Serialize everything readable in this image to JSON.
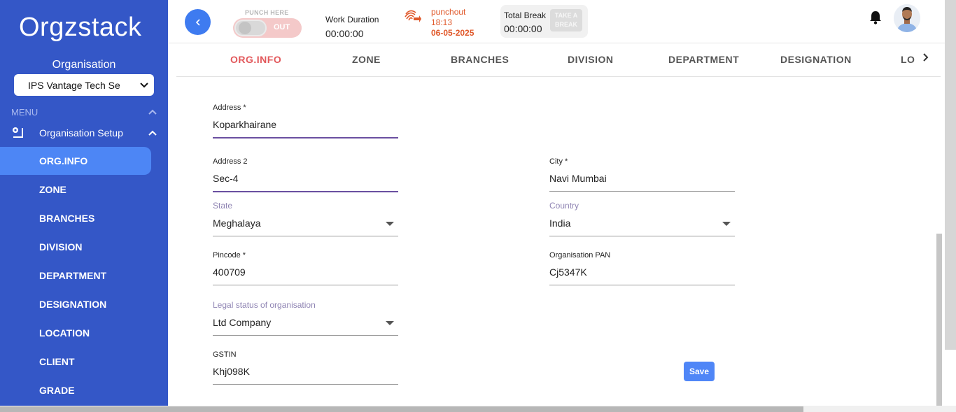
{
  "sidebar": {
    "logo": "Orgzstack",
    "org_label": "Organisation",
    "org_select_value": "IPS Vantage Tech Se",
    "menu_heading": "MENU",
    "setup_label": "Organisation Setup",
    "items": [
      {
        "label": "ORG.INFO",
        "active": true
      },
      {
        "label": "ZONE"
      },
      {
        "label": "BRANCHES"
      },
      {
        "label": "DIVISION"
      },
      {
        "label": "DEPARTMENT"
      },
      {
        "label": "DESIGNATION"
      },
      {
        "label": "LOCATION"
      },
      {
        "label": "CLIENT"
      },
      {
        "label": "GRADE"
      }
    ]
  },
  "topbar": {
    "punch_label": "PUNCH HERE",
    "punch_state": "OUT",
    "work_duration_label": "Work Duration",
    "work_duration_value": "00:00:00",
    "punchout_label": "punchout",
    "punchout_time": "18:13",
    "punchout_date": "06-05-2025",
    "total_break_label": "Total Break",
    "total_break_value": "00:00:00",
    "take_break_line1": "TAKE A",
    "take_break_line2": "BREAK"
  },
  "tabs": [
    "ORG.INFO",
    "ZONE",
    "BRANCHES",
    "DIVISION",
    "DEPARTMENT",
    "DESIGNATION",
    "LO"
  ],
  "form": {
    "address": {
      "label": "Address *",
      "value": "Koparkhairane"
    },
    "address2": {
      "label": "Address 2",
      "value": "Sec-4"
    },
    "city": {
      "label": "City *",
      "value": "Navi Mumbai"
    },
    "state": {
      "label": "State",
      "value": "Meghalaya"
    },
    "country": {
      "label": "Country",
      "value": "India"
    },
    "pincode": {
      "label": "Pincode *",
      "value": "400709"
    },
    "pan": {
      "label": "Organisation PAN",
      "value": "Cj5347K"
    },
    "legal_status": {
      "label": "Legal status of organisation",
      "value": "Ltd Company"
    },
    "gstin": {
      "label": "GSTIN",
      "value": "Khj098K"
    },
    "save_label": "Save"
  },
  "colors": {
    "sidebar_bg": "#3457c7",
    "active_item": "#4d86f5",
    "active_tab": "#e2585b",
    "punchout": "#e0582a",
    "save_button": "#4f86f7"
  }
}
